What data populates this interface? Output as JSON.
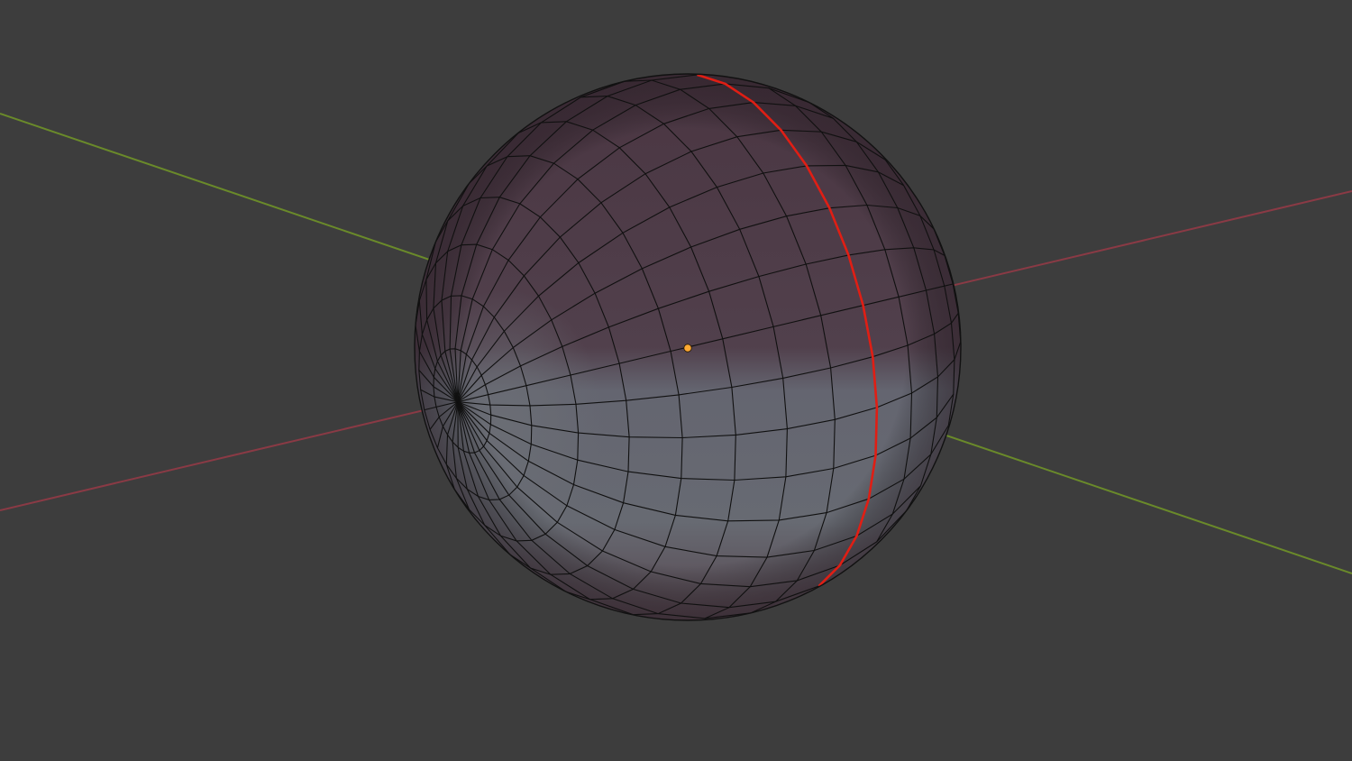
{
  "viewport": {
    "background_color": "#3d3d3d",
    "x_axis_color": "#8a3a45",
    "y_axis_color": "#6a8a2a",
    "object": {
      "type": "uv-sphere",
      "mode": "edit",
      "segments": 32,
      "rings": 16,
      "shading_top_color": "#4a3642",
      "shading_bottom_color": "#666a72",
      "wire_color": "#101010",
      "selected_edge_color": "#e01e14",
      "origin_color": "#ffaa33"
    }
  }
}
